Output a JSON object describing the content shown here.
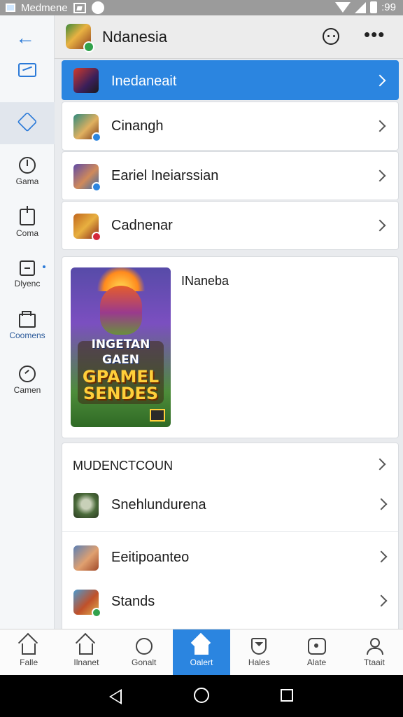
{
  "status_bar": {
    "app_label": "Medmene",
    "time": ":99"
  },
  "sidebar": {
    "items": [
      {
        "label": "",
        "icon": "inbox-icon"
      },
      {
        "label": "",
        "icon": "home-icon"
      },
      {
        "label": "Gama",
        "icon": "power-icon"
      },
      {
        "label": "Coma",
        "icon": "clipboard-icon"
      },
      {
        "label": "Dlyenc",
        "icon": "document-icon"
      },
      {
        "label": "Coomens",
        "icon": "folder-icon"
      },
      {
        "label": "Camen",
        "icon": "clock-icon"
      }
    ]
  },
  "header": {
    "title": "Ndanesia"
  },
  "rows": [
    {
      "label": "Inedaneait",
      "active": true,
      "thumb_color": "#7a3d2a",
      "badge_color": ""
    },
    {
      "label": "Cinangh",
      "active": false,
      "thumb_color": "#2f8a7d",
      "badge_color": "#2b85e0"
    },
    {
      "label": "Eariel Ineiarssian",
      "active": false,
      "thumb_color": "#5d4aa8",
      "badge_color": "#2b85e0"
    },
    {
      "label": "Cadnenar",
      "active": false,
      "thumb_color": "#c0661e",
      "badge_color": "#d4283a"
    }
  ],
  "feature": {
    "title": "INaneba",
    "poster_lines": [
      "INGETAN",
      "GAEN",
      "GPAMEL",
      "SENDES"
    ]
  },
  "section": {
    "title": "MUDENCTCOUN",
    "items": [
      {
        "label": "Snehlundurena",
        "thumb_color": "#4a6a3a",
        "badge_color": ""
      },
      {
        "label": "Eeitipoanteo",
        "thumb_color": "#5a7fb5",
        "badge_color": ""
      },
      {
        "label": "Stands",
        "thumb_color": "#4a9ad0",
        "badge_color": "#31a24c"
      }
    ]
  },
  "bottom_nav": {
    "items": [
      {
        "label": "Falle",
        "icon": "home-icon",
        "active": false
      },
      {
        "label": "Ilnanet",
        "icon": "home-icon",
        "active": false
      },
      {
        "label": "Gonalt",
        "icon": "chat-bubble-icon",
        "active": false
      },
      {
        "label": "Oalert",
        "icon": "home-icon",
        "active": true
      },
      {
        "label": "Hales",
        "icon": "shield-icon",
        "active": false
      },
      {
        "label": "Alate",
        "icon": "camera-icon",
        "active": false
      },
      {
        "label": "Ttaait",
        "icon": "person-icon",
        "active": false
      }
    ]
  },
  "colors": {
    "accent": "#2b85e0",
    "online": "#31a24c"
  }
}
